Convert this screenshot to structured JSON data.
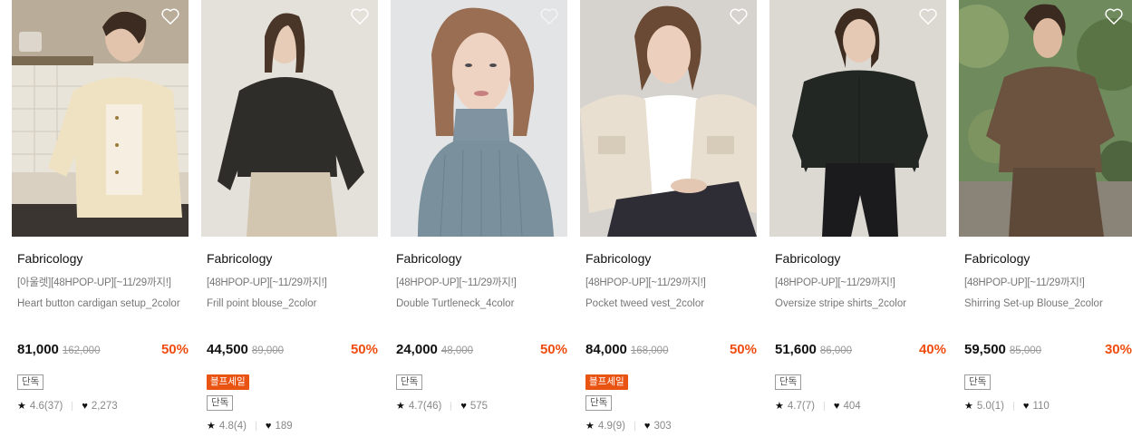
{
  "products": [
    {
      "brand": "Fabricology",
      "promo": "[아울렛][48HPOP-UP][~11/29까지!]",
      "name": "Heart button cardigan setup_2color",
      "price": "81,000",
      "original_price": "162,000",
      "discount": "50%",
      "sale_badge": "",
      "solo_badge": "단독",
      "rating": "4.6(37)",
      "likes": "2,273"
    },
    {
      "brand": "Fabricology",
      "promo": "[48HPOP-UP][~11/29까지!]",
      "name": "Frill point blouse_2color",
      "price": "44,500",
      "original_price": "89,000",
      "discount": "50%",
      "sale_badge": "블프세일",
      "solo_badge": "단독",
      "rating": "4.8(4)",
      "likes": "189"
    },
    {
      "brand": "Fabricology",
      "promo": "[48HPOP-UP][~11/29까지!]",
      "name": "Double Turtleneck_4color",
      "price": "24,000",
      "original_price": "48,000",
      "discount": "50%",
      "sale_badge": "",
      "solo_badge": "단독",
      "rating": "4.7(46)",
      "likes": "575"
    },
    {
      "brand": "Fabricology",
      "promo": "[48HPOP-UP][~11/29까지!]",
      "name": "Pocket tweed vest_2color",
      "price": "84,000",
      "original_price": "168,000",
      "discount": "50%",
      "sale_badge": "블프세일",
      "solo_badge": "단독",
      "rating": "4.9(9)",
      "likes": "303"
    },
    {
      "brand": "Fabricology",
      "promo": "[48HPOP-UP][~11/29까지!]",
      "name": "Oversize stripe shirts_2color",
      "price": "51,600",
      "original_price": "86,000",
      "discount": "40%",
      "sale_badge": "",
      "solo_badge": "단독",
      "rating": "4.7(7)",
      "likes": "404"
    },
    {
      "brand": "Fabricology",
      "promo": "[48HPOP-UP][~11/29까지!]",
      "name": "Shirring Set-up Blouse_2color",
      "price": "59,500",
      "original_price": "85,000",
      "discount": "30%",
      "sale_badge": "",
      "solo_badge": "단독",
      "rating": "5.0(1)",
      "likes": "110"
    }
  ],
  "icons": {
    "wishlist": "heart-outline-icon",
    "rating": "star-icon",
    "likes": "heart-filled-icon"
  },
  "colors": {
    "discount": "#ef4d0f",
    "sale_badge": "#ea5413"
  }
}
